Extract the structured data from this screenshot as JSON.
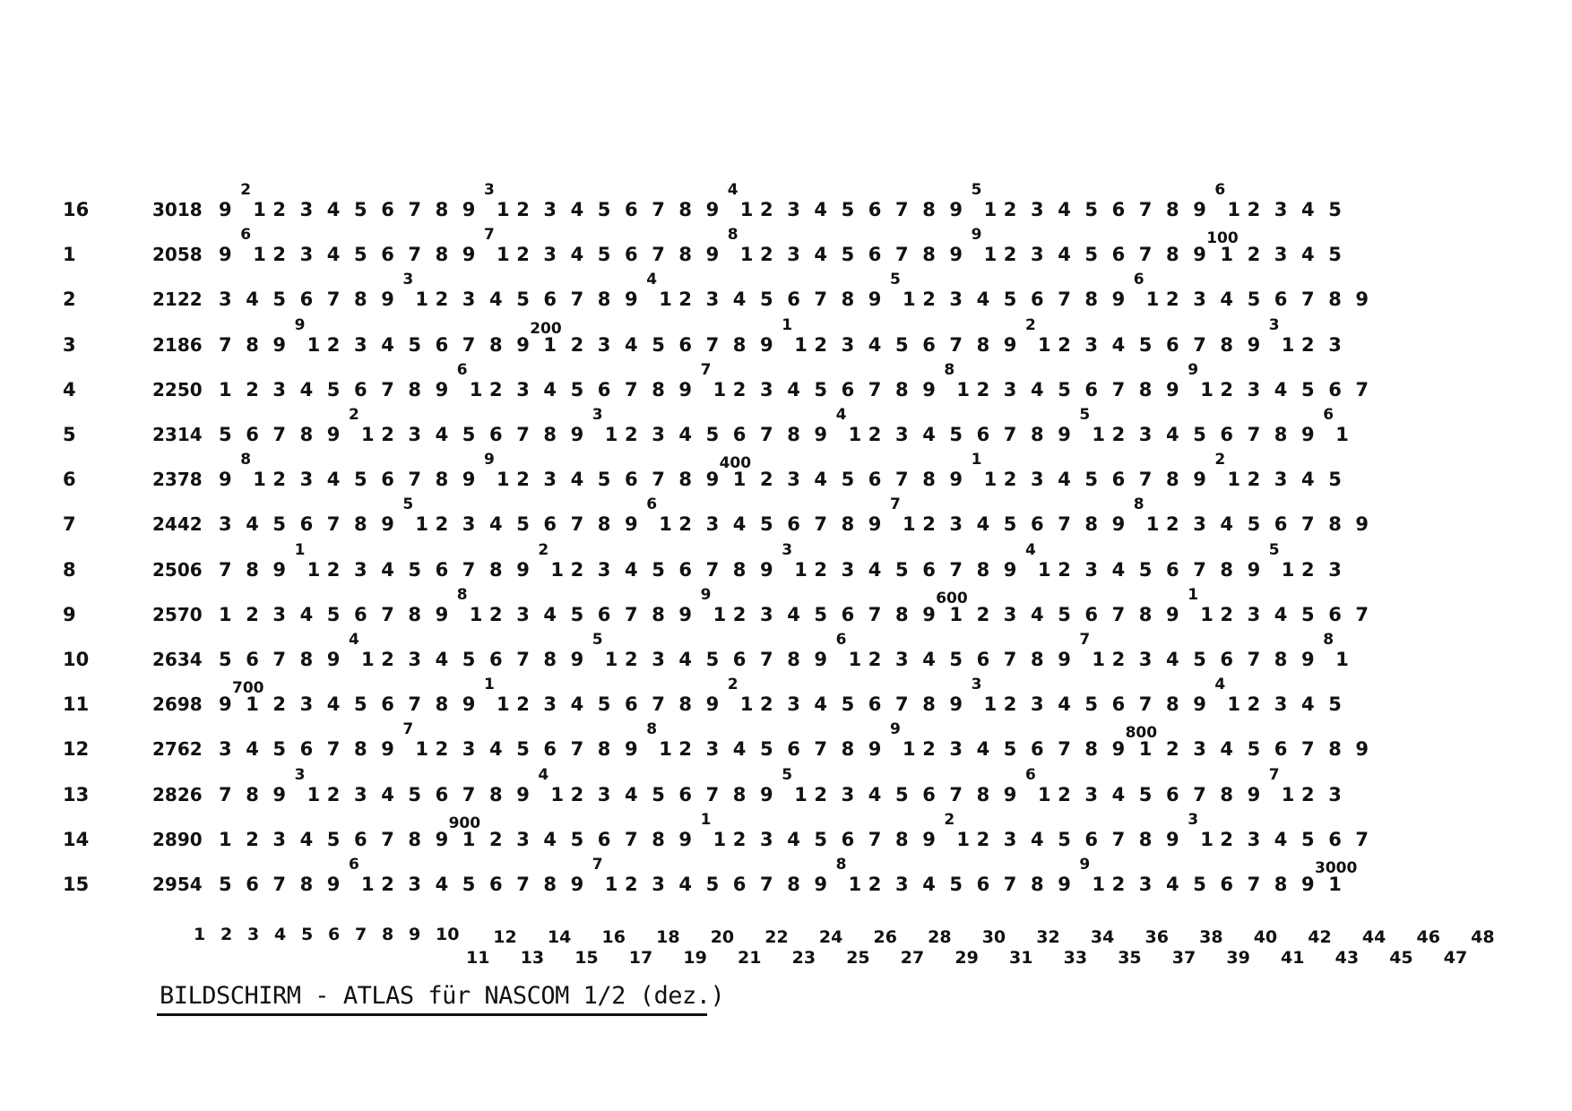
{
  "rows": [
    {
      "label": "16",
      "address": "3018",
      "cells": "9 ²1 2 3 4 5 6 7 8 9 ³1 2 3 4 5 6 7 8 9 ⁴1 2 3 4 5 6 7 8 9 ⁵1 2 3 4 5 6 7 8 9 ⁶1 2 3 4 5"
    },
    {
      "label": "1",
      "address": "2058",
      "cells": "9 ⁶1 2 3 4 5 6 7 8 9 ⁷1 2 3 4 5 6 7 8 9 ⁸1 2 3 4 5 6 7 8 9 ⁹1 2 3 4 5 6 7 8 9^100 1 2 3 4 5"
    },
    {
      "label": "2",
      "address": "2122",
      "cells": "3 4 5 6 7 8 9 ³1 2 3 4 5 6 7 8 9 ⁴1 2 3 4 5 6 7 8 9 ⁵1 2 3 4 5 6 7 8 9 ⁶1 2 3 4 5 6 7 8 9"
    },
    {
      "label": "3",
      "address": "2186",
      "cells": "7 8 9 ⁹1 2 3 4 5 6 7 8 9^200 1 2 3 4 5 6 7 8 9 ¹1 2 3 4 5 6 7 8 9 ²1 2 3 4 5 6 7 8 9 ³1 2 3"
    },
    {
      "label": "4",
      "address": "2250",
      "cells": "1 2 3 4 5 6 7 8 9 ⁶1 2 3 4 5 6 7 8 9 ⁷1 2 3 4 5 6 7 8 9 ⁸1 2 3 4 5 6 7 8 9 ⁹1 2 3 4 5 6 7"
    },
    {
      "label": "5",
      "address": "2314",
      "cells": "5 6 7 8 9 ²1 2 3 4 5 6 7 8 9 ³1 2 3 4 5 6 7 8 9 ⁴1 2 3 4 5 6 7 8 9 ⁵1 2 3 4 5 6 7 8 9 ⁶1"
    },
    {
      "label": "6",
      "address": "2378",
      "cells": "9 ⁸1 2 3 4 5 6 7 8 9 ⁹1 2 3 4 5 6 7 8 9^400 1 2 3 4 5 6 7 8 9 ¹1 2 3 4 5 6 7 8 9 ²1 2 3 4 5"
    },
    {
      "label": "7",
      "address": "2442",
      "cells": "3 4 5 6 7 8 9 ⁵1 2 3 4 5 6 7 8 9 ⁶1 2 3 4 5 6 7 8 9 ⁷1 2 3 4 5 6 7 8 9 ⁸1 2 3 4 5 6 7 8 9"
    },
    {
      "label": "8",
      "address": "2506",
      "cells": "7 8 9 ¹1 2 3 4 5 6 7 8 9 ²1 2 3 4 5 6 7 8 9 ³1 2 3 4 5 6 7 8 9 ⁴1 2 3 4 5 6 7 8 9 ⁵1 2 3"
    },
    {
      "label": "9",
      "address": "2570",
      "cells": "1 2 3 4 5 6 7 8 9 ⁸1 2 3 4 5 6 7 8 9 ⁹1 2 3 4 5 6 7 8 9^600 1 2 3 4 5 6 7 8 9 ¹1 2 3 4 5 6 7"
    },
    {
      "label": "10",
      "address": "2634",
      "cells": "5 6 7 8 9 ⁴1 2 3 4 5 6 7 8 9 ⁵1 2 3 4 5 6 7 8 9 ⁶1 2 3 4 5 6 7 8 9 ⁷1 2 3 4 5 6 7 8 9 ⁸1"
    },
    {
      "label": "11",
      "address": "2698",
      "cells": "9^700 1 2 3 4 5 6 7 8 9 ¹1 2 3 4 5 6 7 8 9 ²1 2 3 4 5 6 7 8 9 ³1 2 3 4 5 6 7 8 9 ⁴1 2 3 4 5"
    },
    {
      "label": "12",
      "address": "2762",
      "cells": "3 4 5 6 7 8 9 ⁷1 2 3 4 5 6 7 8 9 ⁸1 2 3 4 5 6 7 8 9 ⁹1 2 3 4 5 6 7 8 9^800 1 2 3 4 5 6 7 8 9"
    },
    {
      "label": "13",
      "address": "2826",
      "cells": "7 8 9 ³1 2 3 4 5 6 7 8 9 ⁴1 2 3 4 5 6 7 8 9 ⁵1 2 3 4 5 6 7 8 9 ⁶1 2 3 4 5 6 7 8 9 ⁷1 2 3"
    },
    {
      "label": "14",
      "address": "2890",
      "cells": "1 2 3 4 5 6 7 8 9^900 1 2 3 4 5 6 7 8 9 ¹1 2 3 4 5 6 7 8 9 ²1 2 3 4 5 6 7 8 9 ³1 2 3 4 5 6 7"
    },
    {
      "label": "15",
      "address": "2954",
      "cells": "5 6 7 8 9 ⁶1 2 3 4 5 6 7 8 9 ⁷1 2 3 4 5 6 7 8 9 ⁸1 2 3 4 5 6 7 8 9 ⁹1 2 3 4 5 6 7 8 9^3000 1"
    }
  ],
  "column_numbers": [
    "1",
    "2",
    "3",
    "4",
    "5",
    "6",
    "7",
    "8",
    "9",
    "10",
    "11",
    "12",
    "13",
    "14",
    "15",
    "16",
    "17",
    "18",
    "19",
    "20",
    "21",
    "22",
    "23",
    "24",
    "25",
    "26",
    "27",
    "28",
    "29",
    "30",
    "31",
    "32",
    "33",
    "34",
    "35",
    "36",
    "37",
    "38",
    "39",
    "40",
    "41",
    "42",
    "43",
    "44",
    "45",
    "46",
    "47",
    "48"
  ],
  "caption": "BILDSCHIRM - ATLAS für NASCOM 1/2 (dez.)"
}
